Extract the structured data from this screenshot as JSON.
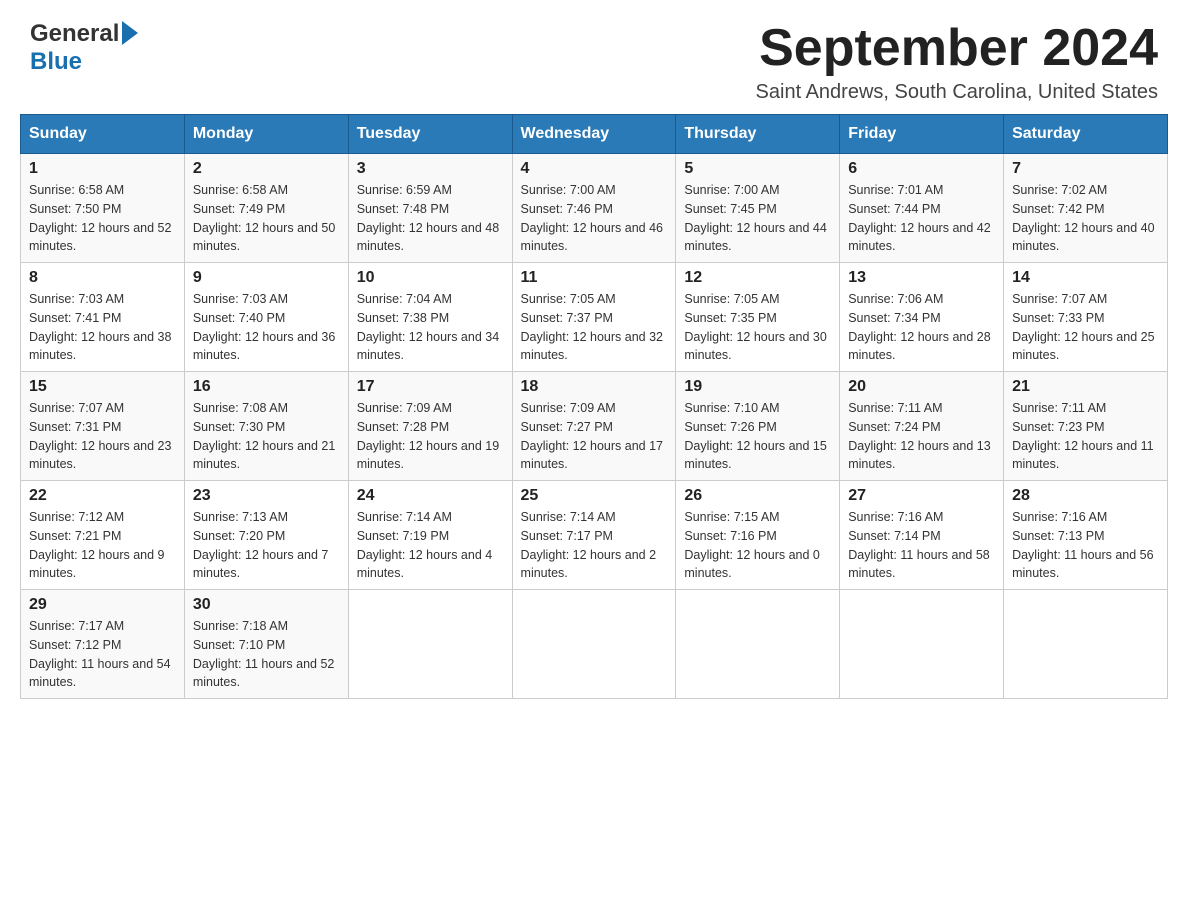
{
  "header": {
    "month_title": "September 2024",
    "subtitle": "Saint Andrews, South Carolina, United States",
    "logo_general": "General",
    "logo_blue": "Blue"
  },
  "days_of_week": [
    "Sunday",
    "Monday",
    "Tuesday",
    "Wednesday",
    "Thursday",
    "Friday",
    "Saturday"
  ],
  "weeks": [
    [
      {
        "day": "1",
        "sunrise": "6:58 AM",
        "sunset": "7:50 PM",
        "daylight": "12 hours and 52 minutes."
      },
      {
        "day": "2",
        "sunrise": "6:58 AM",
        "sunset": "7:49 PM",
        "daylight": "12 hours and 50 minutes."
      },
      {
        "day": "3",
        "sunrise": "6:59 AM",
        "sunset": "7:48 PM",
        "daylight": "12 hours and 48 minutes."
      },
      {
        "day": "4",
        "sunrise": "7:00 AM",
        "sunset": "7:46 PM",
        "daylight": "12 hours and 46 minutes."
      },
      {
        "day": "5",
        "sunrise": "7:00 AM",
        "sunset": "7:45 PM",
        "daylight": "12 hours and 44 minutes."
      },
      {
        "day": "6",
        "sunrise": "7:01 AM",
        "sunset": "7:44 PM",
        "daylight": "12 hours and 42 minutes."
      },
      {
        "day": "7",
        "sunrise": "7:02 AM",
        "sunset": "7:42 PM",
        "daylight": "12 hours and 40 minutes."
      }
    ],
    [
      {
        "day": "8",
        "sunrise": "7:03 AM",
        "sunset": "7:41 PM",
        "daylight": "12 hours and 38 minutes."
      },
      {
        "day": "9",
        "sunrise": "7:03 AM",
        "sunset": "7:40 PM",
        "daylight": "12 hours and 36 minutes."
      },
      {
        "day": "10",
        "sunrise": "7:04 AM",
        "sunset": "7:38 PM",
        "daylight": "12 hours and 34 minutes."
      },
      {
        "day": "11",
        "sunrise": "7:05 AM",
        "sunset": "7:37 PM",
        "daylight": "12 hours and 32 minutes."
      },
      {
        "day": "12",
        "sunrise": "7:05 AM",
        "sunset": "7:35 PM",
        "daylight": "12 hours and 30 minutes."
      },
      {
        "day": "13",
        "sunrise": "7:06 AM",
        "sunset": "7:34 PM",
        "daylight": "12 hours and 28 minutes."
      },
      {
        "day": "14",
        "sunrise": "7:07 AM",
        "sunset": "7:33 PM",
        "daylight": "12 hours and 25 minutes."
      }
    ],
    [
      {
        "day": "15",
        "sunrise": "7:07 AM",
        "sunset": "7:31 PM",
        "daylight": "12 hours and 23 minutes."
      },
      {
        "day": "16",
        "sunrise": "7:08 AM",
        "sunset": "7:30 PM",
        "daylight": "12 hours and 21 minutes."
      },
      {
        "day": "17",
        "sunrise": "7:09 AM",
        "sunset": "7:28 PM",
        "daylight": "12 hours and 19 minutes."
      },
      {
        "day": "18",
        "sunrise": "7:09 AM",
        "sunset": "7:27 PM",
        "daylight": "12 hours and 17 minutes."
      },
      {
        "day": "19",
        "sunrise": "7:10 AM",
        "sunset": "7:26 PM",
        "daylight": "12 hours and 15 minutes."
      },
      {
        "day": "20",
        "sunrise": "7:11 AM",
        "sunset": "7:24 PM",
        "daylight": "12 hours and 13 minutes."
      },
      {
        "day": "21",
        "sunrise": "7:11 AM",
        "sunset": "7:23 PM",
        "daylight": "12 hours and 11 minutes."
      }
    ],
    [
      {
        "day": "22",
        "sunrise": "7:12 AM",
        "sunset": "7:21 PM",
        "daylight": "12 hours and 9 minutes."
      },
      {
        "day": "23",
        "sunrise": "7:13 AM",
        "sunset": "7:20 PM",
        "daylight": "12 hours and 7 minutes."
      },
      {
        "day": "24",
        "sunrise": "7:14 AM",
        "sunset": "7:19 PM",
        "daylight": "12 hours and 4 minutes."
      },
      {
        "day": "25",
        "sunrise": "7:14 AM",
        "sunset": "7:17 PM",
        "daylight": "12 hours and 2 minutes."
      },
      {
        "day": "26",
        "sunrise": "7:15 AM",
        "sunset": "7:16 PM",
        "daylight": "12 hours and 0 minutes."
      },
      {
        "day": "27",
        "sunrise": "7:16 AM",
        "sunset": "7:14 PM",
        "daylight": "11 hours and 58 minutes."
      },
      {
        "day": "28",
        "sunrise": "7:16 AM",
        "sunset": "7:13 PM",
        "daylight": "11 hours and 56 minutes."
      }
    ],
    [
      {
        "day": "29",
        "sunrise": "7:17 AM",
        "sunset": "7:12 PM",
        "daylight": "11 hours and 54 minutes."
      },
      {
        "day": "30",
        "sunrise": "7:18 AM",
        "sunset": "7:10 PM",
        "daylight": "11 hours and 52 minutes."
      },
      null,
      null,
      null,
      null,
      null
    ]
  ]
}
